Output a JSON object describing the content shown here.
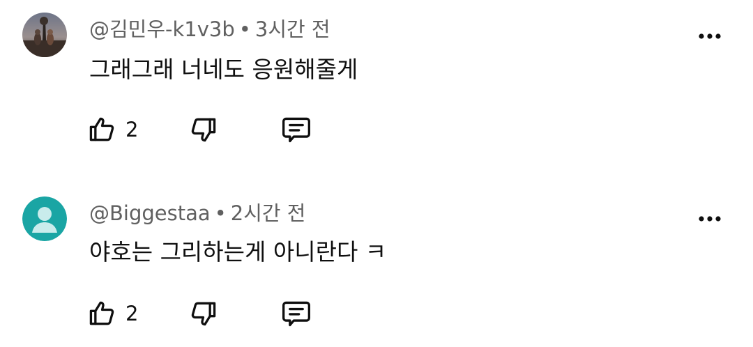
{
  "comments": [
    {
      "author": "@김민우-k1v3b",
      "separator": "•",
      "time": "3시간 전",
      "text": "그래그래 너네도 응원해줄게",
      "likes": "2",
      "avatar": "photo-avatar"
    },
    {
      "author": "@Biggestaa",
      "separator": "•",
      "time": "2시간 전",
      "text": "야호는 그리하는게 아니란다 ㅋ",
      "likes": "2",
      "avatar": "default-person-avatar",
      "avatar_color": "#1aa5a4"
    }
  ],
  "icons": {
    "like": "thumb-up-icon",
    "dislike": "thumb-down-icon",
    "reply": "reply-icon",
    "more": "more-vert-icon"
  }
}
